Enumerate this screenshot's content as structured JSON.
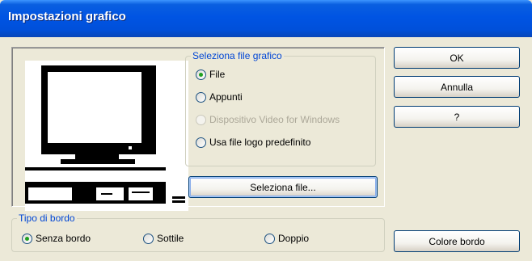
{
  "window": {
    "title": "Impostazioni grafico"
  },
  "source_group": {
    "legend": "Seleziona file grafico",
    "options": [
      {
        "label": "File",
        "checked": true,
        "disabled": false
      },
      {
        "label": "Appunti",
        "checked": false,
        "disabled": false
      },
      {
        "label": "Dispositivo Video for Windows",
        "checked": false,
        "disabled": true
      },
      {
        "label": "Usa file logo predefinito",
        "checked": false,
        "disabled": false
      }
    ],
    "select_button": "Seleziona file..."
  },
  "border_group": {
    "legend": "Tipo di bordo",
    "options": [
      {
        "label": "Senza bordo",
        "checked": true
      },
      {
        "label": "Sottile",
        "checked": false
      },
      {
        "label": "Doppio",
        "checked": false
      }
    ]
  },
  "buttons": {
    "ok": "OK",
    "cancel": "Annulla",
    "help": "?",
    "border_color": "Colore bordo"
  },
  "preview": {
    "image": "computer-monitor-icon"
  },
  "colors": {
    "title_bar": "#0054e3",
    "legend_text": "#0046d5",
    "face": "#ece9d8"
  }
}
